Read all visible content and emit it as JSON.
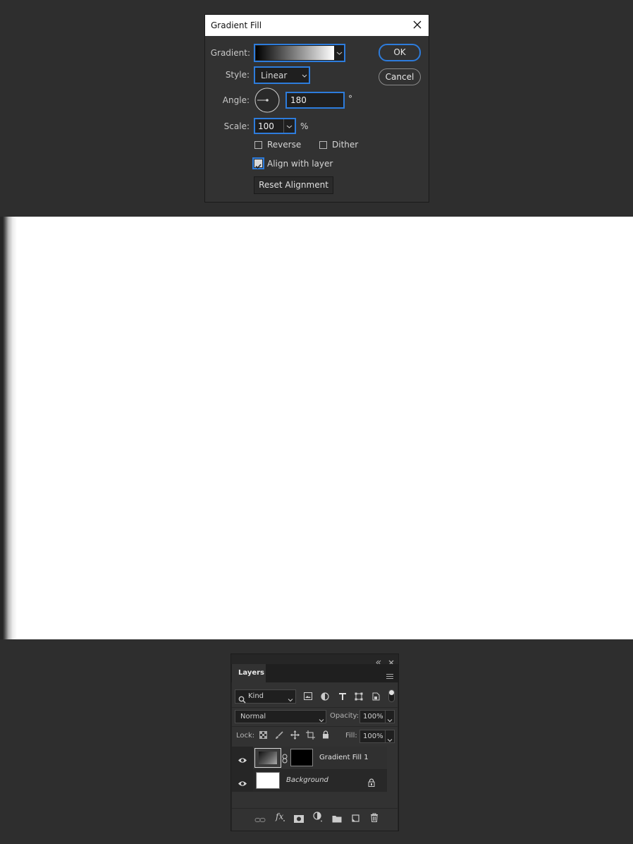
{
  "dialog": {
    "title": "Gradient Fill",
    "gradient_label": "Gradient:",
    "style_label": "Style:",
    "style_value": "Linear",
    "angle_label": "Angle:",
    "angle_value": "180",
    "degree_symbol": "°",
    "scale_label": "Scale:",
    "scale_value": "100",
    "percent_symbol": "%",
    "reverse_label": "Reverse",
    "reverse_checked": false,
    "dither_label": "Dither",
    "dither_checked": false,
    "align_label": "Align with layer",
    "align_checked": true,
    "reset_alignment_label": "Reset Alignment",
    "ok_label": "OK",
    "cancel_label": "Cancel",
    "accent_color": "#2d7cdc"
  },
  "layers_panel": {
    "tab_label": "Layers",
    "filter_kind": "Kind",
    "blend_mode": "Normal",
    "opacity_label": "Opacity:",
    "opacity_value": "100%",
    "lock_label": "Lock:",
    "fill_label": "Fill:",
    "fill_value": "100%",
    "layers": [
      {
        "name": "Gradient Fill 1",
        "visible": true,
        "selected": true
      },
      {
        "name": "Background",
        "visible": true,
        "locked": true
      }
    ],
    "icons": [
      "collapse-icon",
      "close-icon",
      "panel-menu-icon",
      "search-icon",
      "image-filter-icon",
      "adjustment-filter-icon",
      "type-filter-icon",
      "shape-filter-icon",
      "smart-object-filter-icon",
      "filter-toggle-icon",
      "lock-transparent-icon",
      "lock-paint-icon",
      "lock-position-icon",
      "lock-artboard-icon",
      "lock-all-icon",
      "link-icon",
      "fx-icon",
      "mask-icon",
      "adjustment-icon",
      "folder-icon",
      "new-layer-icon",
      "trash-icon"
    ]
  }
}
